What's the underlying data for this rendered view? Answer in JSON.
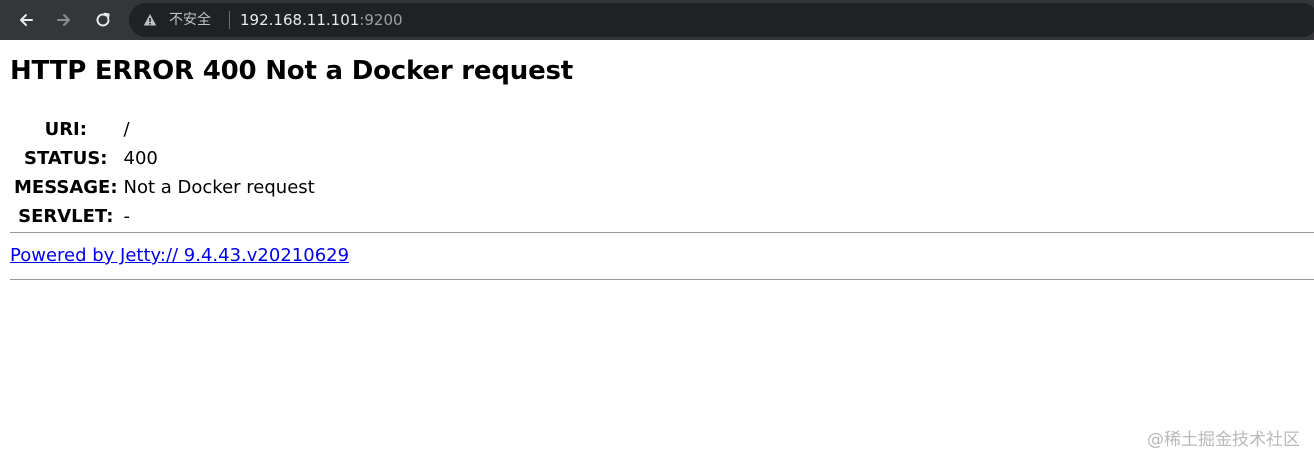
{
  "browser": {
    "icons": {
      "back": "arrow-left-icon",
      "forward": "arrow-right-icon",
      "reload": "reload-icon",
      "security": "warning-triangle-icon"
    },
    "security_label": "不安全",
    "url_host": "192.168.11.101",
    "url_port": ":9200"
  },
  "page": {
    "title": "HTTP ERROR 400 Not a Docker request",
    "rows": [
      {
        "label": "URI:",
        "value": "/"
      },
      {
        "label": "STATUS:",
        "value": "400"
      },
      {
        "label": "MESSAGE:",
        "value": "Not a Docker request"
      },
      {
        "label": "SERVLET:",
        "value": "-"
      }
    ],
    "powered_by": "Powered by Jetty:// 9.4.43.v20210629"
  },
  "watermark": "@稀土掘金技术社区",
  "colors": {
    "toolbar_bg": "#35363a",
    "omnibox_bg": "#202124",
    "link": "#0000ee"
  }
}
